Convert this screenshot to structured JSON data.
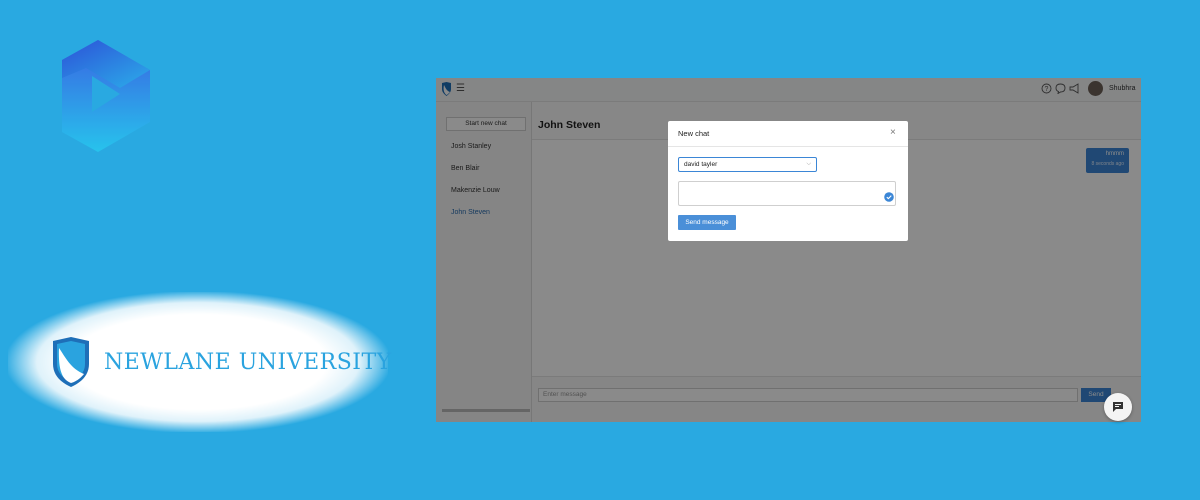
{
  "brand": {
    "play_logo_icon": "play-triangle-logo-icon",
    "university_name": "NEWLANE UNIVERSITY",
    "university_shield_icon": "shield-logo-icon"
  },
  "app": {
    "topbar": {
      "logo_icon": "shield-logo-icon",
      "menu_icon": "menu-icon",
      "menu_glyph": "☰",
      "help_icon": "help-circle-icon",
      "chat_icon": "chat-bubble-icon",
      "announce_icon": "megaphone-icon",
      "user_name": "Shubhra"
    },
    "sidebar": {
      "new_chat_label": "Start new chat",
      "contacts": [
        "Josh Stanley",
        "Ben Blair",
        "Makenzie Louw",
        "John Steven"
      ],
      "active_contact": "John Steven"
    },
    "chat": {
      "title": "John Steven",
      "messages": [
        {
          "text": "hmmm",
          "time": "8 seconds ago"
        }
      ],
      "input_placeholder": "Enter message",
      "send_label": "Send"
    },
    "modal": {
      "title": "New chat",
      "close_glyph": "×",
      "recipient": "david tayler",
      "caret_glyph": "⌵",
      "message_value": "",
      "send_label": "Send message"
    },
    "fab_icon": "chat-widget-icon"
  },
  "colors": {
    "background": "#29a9e1",
    "accent": "#3b86d6"
  }
}
